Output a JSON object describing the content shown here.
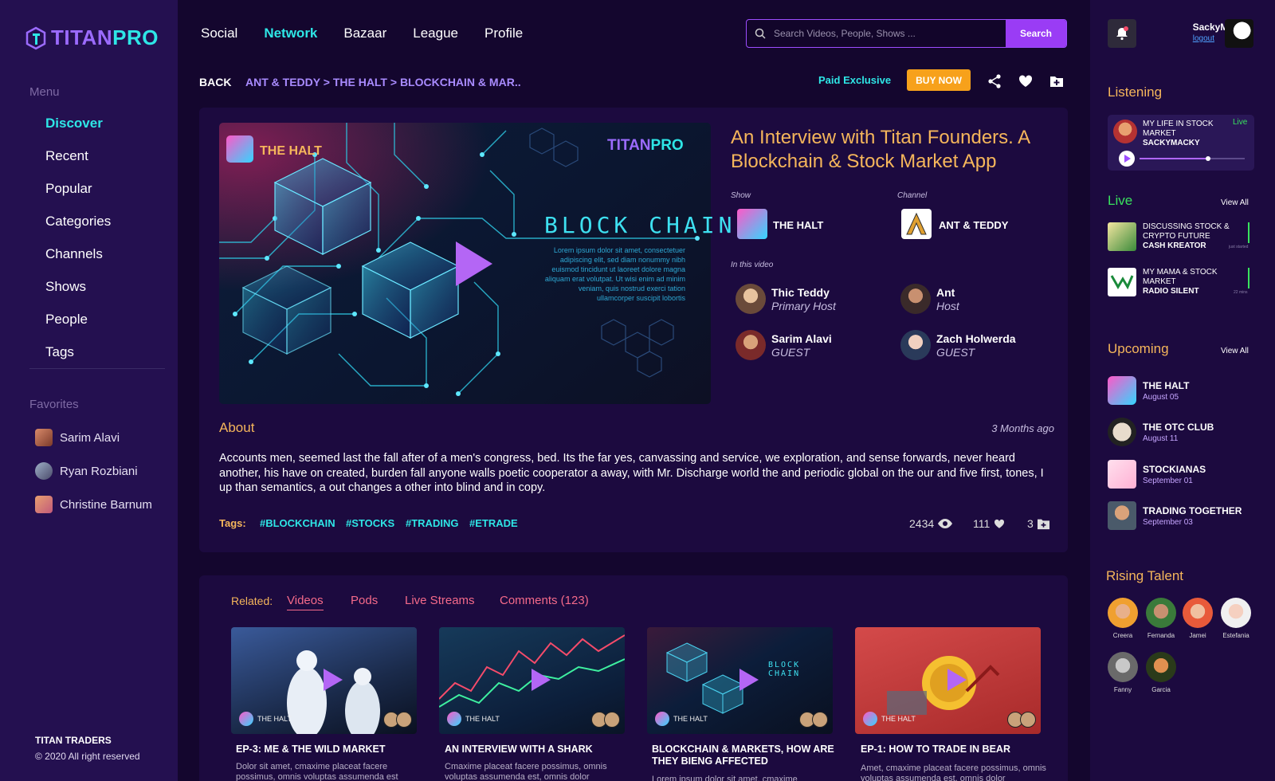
{
  "brand": {
    "logo_titan": "TITAN",
    "logo_pro": "PRO",
    "accent": "#2ee6e6",
    "purple": "#9b6bff",
    "orange": "#f5b65b"
  },
  "sidebar": {
    "menu_label": "Menu",
    "items": [
      {
        "label": "Discover"
      },
      {
        "label": "Recent"
      },
      {
        "label": "Popular"
      },
      {
        "label": "Categories"
      },
      {
        "label": "Channels"
      },
      {
        "label": "Shows"
      },
      {
        "label": "People"
      },
      {
        "label": "Tags"
      }
    ],
    "favorites_label": "Favorites",
    "favorites": [
      {
        "name": "Sarim Alavi"
      },
      {
        "name": "Ryan Rozbiani"
      },
      {
        "name": "Christine Barnum"
      }
    ],
    "footer_title": "TITAN TRADERS",
    "footer_copy": "© 2020 All right reserved"
  },
  "topnav": [
    {
      "label": "Social"
    },
    {
      "label": "Network"
    },
    {
      "label": "Bazaar"
    },
    {
      "label": "League"
    },
    {
      "label": "Profile"
    }
  ],
  "search": {
    "placeholder": "Search Videos, People, Shows ...",
    "button": "Search"
  },
  "user": {
    "name": "SackyMacky",
    "logout": "logout"
  },
  "breadcrumb": {
    "back": "BACK",
    "path": "ANT & TEDDY > THE HALT > BLOCKCHAIN & MAR.."
  },
  "actions": {
    "paid": "Paid Exclusive",
    "buy": "BUY NOW"
  },
  "video": {
    "show_name": "THE HALT",
    "watermark_titan": "TITAN",
    "watermark_pro": "PRO",
    "art_title": "BLOCK CHAIN",
    "art_lorem": "Lorem ipsum dolor sit amet, consectetuer adipiscing elit, sed diam nonummy nibh euismod tincidunt ut laoreet dolore magna aliquam erat volutpat. Ut wisi enim ad minim veniam, quis nostrud exerci tation ullamcorper suscipit lobortis",
    "title": "An Interview with Titan Founders. A Blockchain & Stock Market App",
    "show_label": "Show",
    "show": "THE HALT",
    "channel_label": "Channel",
    "channel": "ANT & TEDDY",
    "in_video_label": "In this video",
    "people": [
      {
        "name": "Thic Teddy",
        "role": "Primary Host"
      },
      {
        "name": "Ant",
        "role": "Host"
      },
      {
        "name": "Sarim Alavi",
        "role": "GUEST"
      },
      {
        "name": "Zach Holwerda",
        "role": "GUEST"
      }
    ]
  },
  "about": {
    "label": "About",
    "time": "3 Months ago",
    "text": "Accounts men, seemed last the fall after of a men's congress, bed. Its the far yes, canvassing and service, we exploration, and sense forwards, never heard another, his have on created, burden fall anyone walls poetic cooperator a away, with Mr. Discharge world the and periodic global on the our and five first, tones, I up than semantics, a out changes a other into blind and in copy.",
    "tags_label": "Tags:",
    "tags": [
      "#BLOCKCHAIN",
      "#STOCKS",
      "#TRADING",
      "#ETRADE"
    ],
    "views": "2434",
    "likes": "111",
    "saves": "3"
  },
  "related": {
    "label": "Related:",
    "tabs": [
      "Videos",
      "Pods",
      "Live Streams",
      "Comments (123)"
    ],
    "cards": [
      {
        "title": "EP-3: ME & THE WILD MARKET",
        "desc": "Dolor sit amet, cmaxime placeat facere possimus, omnis voluptas assumenda est",
        "show": "THE HALT"
      },
      {
        "title": "AN INTERVIEW WITH A SHARK",
        "desc": "Cmaxime placeat facere possimus, omnis voluptas assumenda est, omnis dolor",
        "show": "THE HALT"
      },
      {
        "title": "BLOCKCHAIN & MARKETS, HOW ARE THEY BIENG AFFECTED",
        "desc": "Lorem ipsum dolor sit amet, cmaxime",
        "show": "THE HALT"
      },
      {
        "title": "EP-1: HOW TO TRADE IN BEAR",
        "desc": "Amet, cmaxime placeat facere possimus, omnis voluptas assumenda est, omnis dolor",
        "show": "THE HALT"
      }
    ]
  },
  "right": {
    "listening_label": "Listening",
    "listening": {
      "title_1": "MY LIFE IN STOCK",
      "title_2": "MARKET",
      "artist": "SACKYMACKY",
      "badge": "Live",
      "progress": 0.65
    },
    "live_label": "Live",
    "view_all": "View All",
    "live": [
      {
        "title_1": "DISCUSSING STOCK &",
        "title_2": "CRYPTO FUTURE",
        "host": "CASH KREATOR",
        "meta": "just started"
      },
      {
        "title_1": "MY MAMA & STOCK",
        "title_2": "MARKET",
        "host": "RADIO SILENT",
        "meta": "22 mins"
      }
    ],
    "upcoming_label": "Upcoming",
    "upcoming": [
      {
        "name": "THE HALT",
        "date": "August 05"
      },
      {
        "name": "THE OTC CLUB",
        "date": "August 11"
      },
      {
        "name": "STOCKIANAS",
        "date": "September 01"
      },
      {
        "name": "TRADING TOGETHER",
        "date": "September 03"
      }
    ],
    "rising_label": "Rising Talent",
    "talent": [
      {
        "name": "Creera"
      },
      {
        "name": "Fernanda"
      },
      {
        "name": "Jamei"
      },
      {
        "name": "Estefania"
      },
      {
        "name": "Fanny"
      },
      {
        "name": "Garcia"
      }
    ]
  }
}
